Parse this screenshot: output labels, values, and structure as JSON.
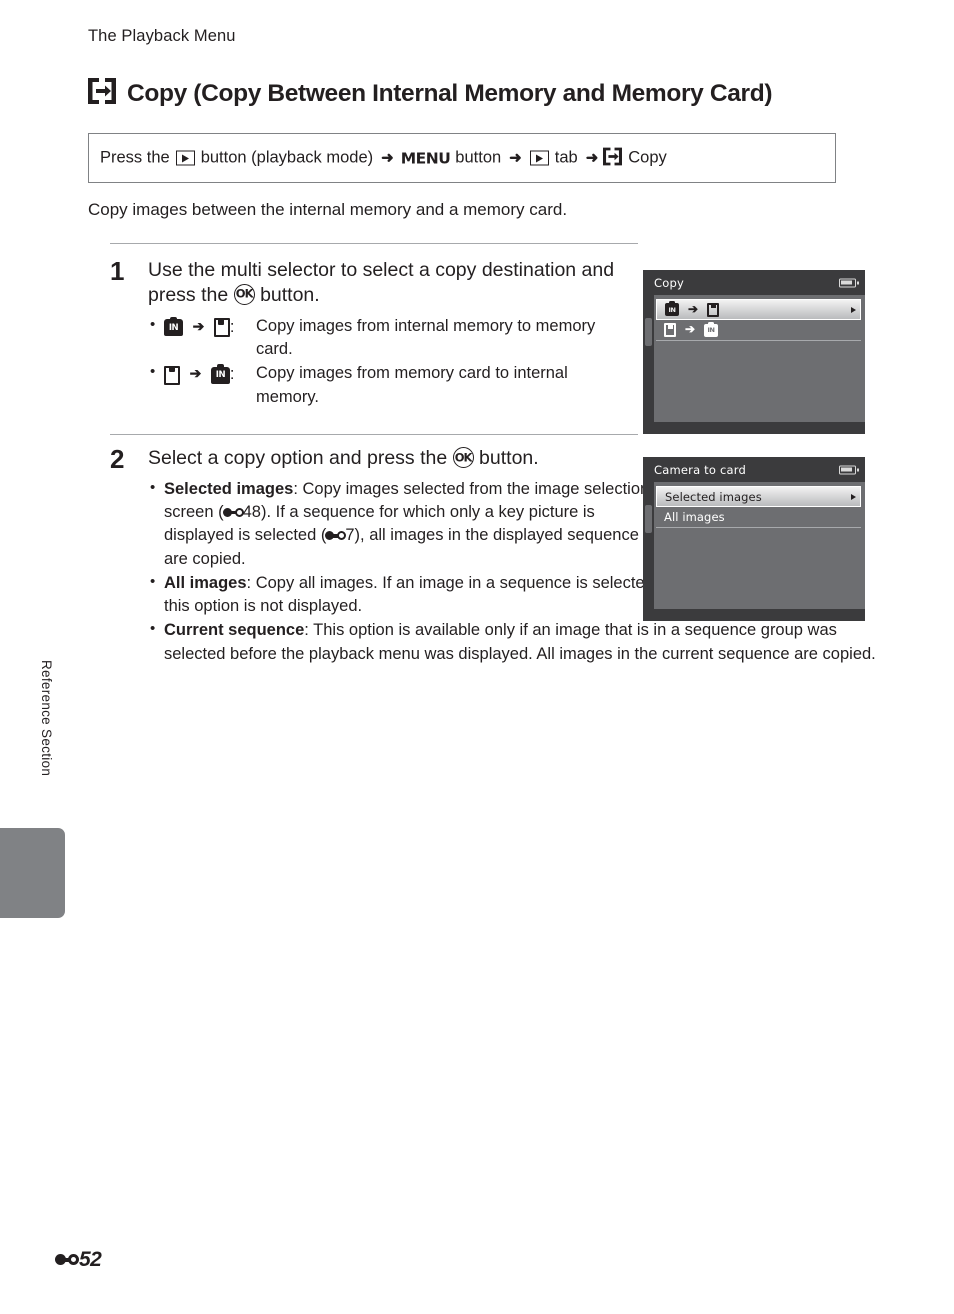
{
  "running_head": "The Playback Menu",
  "chapter": {
    "icon": "copy-icon",
    "title": "Copy (Copy Between Internal Memory and Memory Card)"
  },
  "nav_path": {
    "press_the": "Press the",
    "playback_icon": "playback-button-icon",
    "button_playback_mode": "button (playback mode)",
    "arrow": "➜",
    "menu_word": "MENU",
    "button": "button",
    "tab_icon": "playback-tab-icon",
    "tab": "tab",
    "copy_icon": "copy-icon",
    "copy": "Copy"
  },
  "intro": "Copy images between the internal memory and a memory card.",
  "steps": [
    {
      "number": "1",
      "head_before_ok": "Use the multi selector to select a copy destination and press the",
      "head_after_ok": "button.",
      "ok_label": "OK",
      "bullets": [
        {
          "icons": [
            "internal-memory-icon",
            "arrow-right-icon",
            "memory-card-icon"
          ],
          "colon": ":",
          "text": "Copy images from internal memory to memory card."
        },
        {
          "icons": [
            "memory-card-icon",
            "arrow-right-icon",
            "internal-memory-icon"
          ],
          "colon": ":",
          "text": "Copy images from memory card to internal memory."
        }
      ]
    },
    {
      "number": "2",
      "head_before_ok": "Select a copy option and press the",
      "head_after_ok": "button.",
      "ok_label": "OK",
      "options": [
        {
          "name": "Selected images",
          "text_1": ": Copy images selected from the image selection screen (",
          "ref_1": "48",
          "text_2": "). If a sequence for which only a key picture is displayed is selected (",
          "ref_2": "7",
          "text_3": "), all images in the displayed sequence are copied."
        },
        {
          "name": "All images",
          "text_1": ": Copy all images. If an image in a sequence is selected, this option is not displayed."
        },
        {
          "name": "Current sequence",
          "text_1": ": This option is available only if an image that is in a sequence group was selected before the playback menu was displayed. All images in the current sequence are copied."
        }
      ]
    }
  ],
  "screens": [
    {
      "title": "Copy",
      "battery": "battery-icon",
      "rows": [
        {
          "type": "icons",
          "icons": [
            "internal-memory-icon",
            "arrow-right-icon",
            "memory-card-icon"
          ],
          "selected": true,
          "in_label": "IN"
        },
        {
          "type": "icons",
          "icons": [
            "memory-card-icon",
            "arrow-right-icon",
            "internal-memory-icon"
          ],
          "selected": false,
          "in_label": "IN"
        }
      ]
    },
    {
      "title": "Camera to card",
      "battery": "battery-icon",
      "rows": [
        {
          "type": "text",
          "label": "Selected images",
          "selected": true
        },
        {
          "type": "text",
          "label": "All images",
          "selected": false
        }
      ]
    }
  ],
  "side_label": "Reference Section",
  "folio": {
    "ref_glyph": "e-reference-icon",
    "page": "52"
  }
}
